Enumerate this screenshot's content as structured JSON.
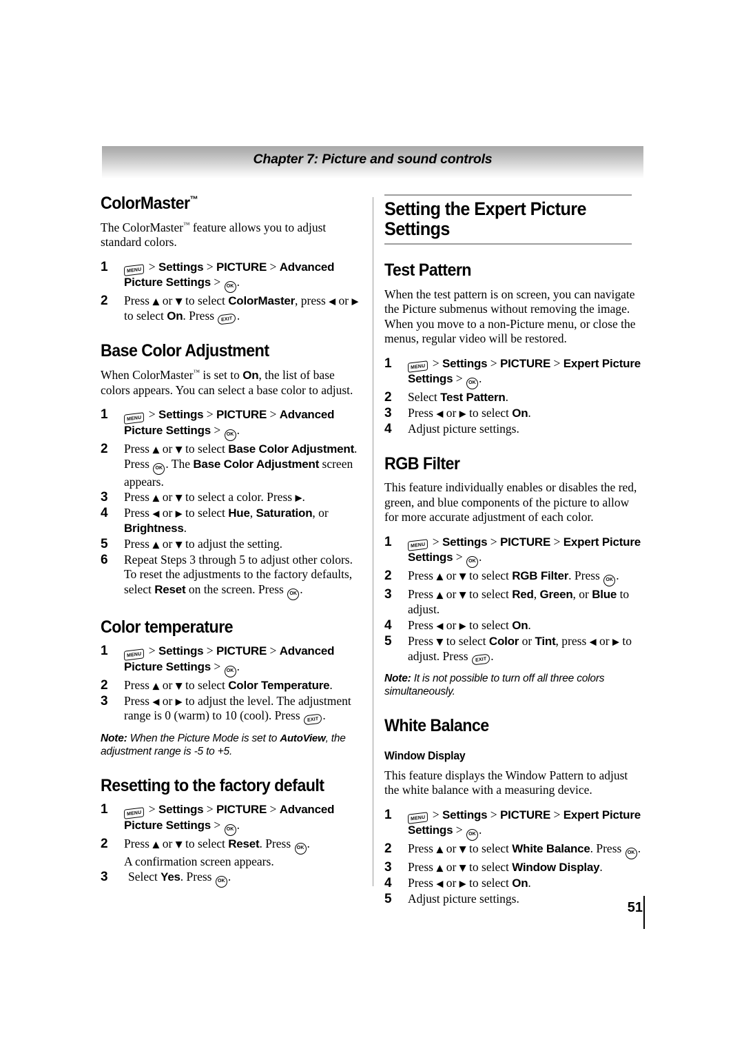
{
  "header": {
    "chapter_title": "Chapter 7: Picture and sound controls"
  },
  "page_number": "51",
  "keys": {
    "menu": "MENU",
    "ok": "OK",
    "exit": "EXIT"
  },
  "left_column": {
    "colormaster": {
      "title": "ColorMaster",
      "title_tm": "™",
      "intro": "The ColorMaster™ feature allows you to adjust standard colors.",
      "steps": [
        {
          "num": "1",
          "text": "MENU > Settings > PICTURE > Advanced Picture Settings > OK."
        },
        {
          "num": "2",
          "text": "Press ▲ or ▼ to select ColorMaster, press ◀ or ▶ to select On. Press EXIT."
        }
      ]
    },
    "base_color_adjustment": {
      "title": "Base Color Adjustment",
      "intro": "When ColorMaster™ is set to On, the list of base colors appears. You can select a base color to adjust.",
      "steps": [
        {
          "num": "1",
          "text": "MENU > Settings > PICTURE > Advanced Picture Settings > OK."
        },
        {
          "num": "2",
          "text": "Press ▲ or ▼ to select Base Color Adjustment. Press OK. The Base Color Adjustment screen appears."
        },
        {
          "num": "3",
          "text": "Press ▲ or ▼ to select a color. Press ▶."
        },
        {
          "num": "4",
          "text": "Press ◀ or ▶ to select Hue, Saturation, or Brightness."
        },
        {
          "num": "5",
          "text": "Press ▲ or ▼ to adjust the setting."
        },
        {
          "num": "6",
          "text": "Repeat Steps 3 through 5 to adjust other colors. To reset the adjustments to the factory defaults, select Reset on the screen. Press OK."
        }
      ]
    },
    "color_temperature": {
      "title": "Color temperature",
      "steps": [
        {
          "num": "1",
          "text": "MENU > Settings > PICTURE > Advanced Picture Settings > OK."
        },
        {
          "num": "2",
          "text": "Press ▲ or ▼ to select Color Temperature."
        },
        {
          "num": "3",
          "text": "Press ◀ or ▶ to adjust the level. The adjustment range is 0 (warm) to 10 (cool). Press EXIT."
        }
      ],
      "note_label": "Note:",
      "note_text": "When the Picture Mode is set to AutoView, the adjustment range is -5 to +5."
    },
    "resetting": {
      "title": "Resetting to the factory default",
      "steps": [
        {
          "num": "1",
          "text": "MENU > Settings > PICTURE > Advanced Picture Settings > OK."
        },
        {
          "num": "2",
          "text": "Press ▲ or ▼ to select Reset. Press OK. A confirmation screen appears."
        },
        {
          "num": "3",
          "text": "Select Yes. Press OK."
        }
      ]
    }
  },
  "right_column": {
    "banner_title": "Setting the Expert Picture Settings",
    "test_pattern": {
      "title": "Test Pattern",
      "intro": "When the test pattern is on screen, you can navigate the Picture submenus without removing the image. When you move to a non-Picture menu, or close the menus, regular video will be restored.",
      "steps": [
        {
          "num": "1",
          "text": "MENU > Settings > PICTURE > Expert Picture Settings > OK."
        },
        {
          "num": "2",
          "text": "Select Test Pattern."
        },
        {
          "num": "3",
          "text": "Press ◀ or ▶ to select On."
        },
        {
          "num": "4",
          "text": "Adjust picture settings."
        }
      ]
    },
    "rgb_filter": {
      "title": "RGB Filter",
      "intro": "This feature individually enables or disables the red, green, and blue components of the picture to allow for more accurate adjustment of each color.",
      "steps": [
        {
          "num": "1",
          "text": "MENU > Settings > PICTURE > Expert Picture Settings > OK."
        },
        {
          "num": "2",
          "text": "Press ▲ or ▼ to select RGB Filter. Press OK."
        },
        {
          "num": "3",
          "text": "Press ▲ or ▼ to select Red, Green, or Blue to adjust."
        },
        {
          "num": "4",
          "text": "Press ◀ or ▶ to select On."
        },
        {
          "num": "5",
          "text": "Press ▼ to select Color or Tint, press ◀ or ▶ to adjust. Press EXIT."
        }
      ],
      "note_label": "Note:",
      "note_text": "It is not possible to turn off all three colors simultaneously."
    },
    "white_balance": {
      "title": "White Balance",
      "subtitle": "Window Display",
      "intro": "This feature displays the Window Pattern to adjust the white balance with a measuring device.",
      "steps": [
        {
          "num": "1",
          "text": "MENU > Settings > PICTURE > Expert Picture Settings > OK."
        },
        {
          "num": "2",
          "text": "Press ▲ or ▼ to select White Balance. Press OK."
        },
        {
          "num": "3",
          "text": "Press ▲ or ▼ to select Window Display."
        },
        {
          "num": "4",
          "text": "Press ◀ or ▶ to select On."
        },
        {
          "num": "5",
          "text": "Adjust picture settings."
        }
      ]
    }
  }
}
